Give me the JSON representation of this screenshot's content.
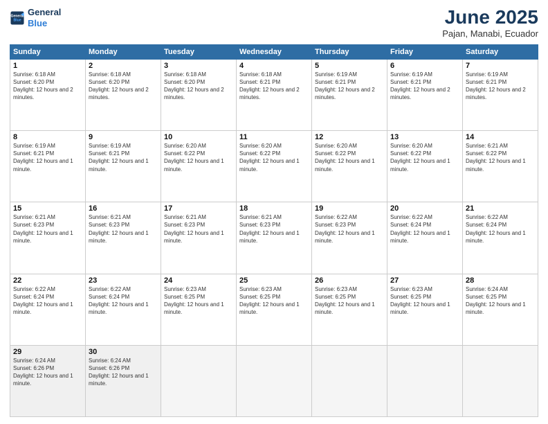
{
  "logo": {
    "line1": "General",
    "line2": "Blue"
  },
  "title": "June 2025",
  "subtitle": "Pajan, Manabi, Ecuador",
  "header_days": [
    "Sunday",
    "Monday",
    "Tuesday",
    "Wednesday",
    "Thursday",
    "Friday",
    "Saturday"
  ],
  "weeks": [
    [
      {
        "day": "1",
        "sunrise": "6:18 AM",
        "sunset": "6:20 PM",
        "daylight": "12 hours and 2 minutes."
      },
      {
        "day": "2",
        "sunrise": "6:18 AM",
        "sunset": "6:20 PM",
        "daylight": "12 hours and 2 minutes."
      },
      {
        "day": "3",
        "sunrise": "6:18 AM",
        "sunset": "6:20 PM",
        "daylight": "12 hours and 2 minutes."
      },
      {
        "day": "4",
        "sunrise": "6:18 AM",
        "sunset": "6:21 PM",
        "daylight": "12 hours and 2 minutes."
      },
      {
        "day": "5",
        "sunrise": "6:19 AM",
        "sunset": "6:21 PM",
        "daylight": "12 hours and 2 minutes."
      },
      {
        "day": "6",
        "sunrise": "6:19 AM",
        "sunset": "6:21 PM",
        "daylight": "12 hours and 2 minutes."
      },
      {
        "day": "7",
        "sunrise": "6:19 AM",
        "sunset": "6:21 PM",
        "daylight": "12 hours and 2 minutes."
      }
    ],
    [
      {
        "day": "8",
        "sunrise": "6:19 AM",
        "sunset": "6:21 PM",
        "daylight": "12 hours and 1 minute."
      },
      {
        "day": "9",
        "sunrise": "6:19 AM",
        "sunset": "6:21 PM",
        "daylight": "12 hours and 1 minute."
      },
      {
        "day": "10",
        "sunrise": "6:20 AM",
        "sunset": "6:22 PM",
        "daylight": "12 hours and 1 minute."
      },
      {
        "day": "11",
        "sunrise": "6:20 AM",
        "sunset": "6:22 PM",
        "daylight": "12 hours and 1 minute."
      },
      {
        "day": "12",
        "sunrise": "6:20 AM",
        "sunset": "6:22 PM",
        "daylight": "12 hours and 1 minute."
      },
      {
        "day": "13",
        "sunrise": "6:20 AM",
        "sunset": "6:22 PM",
        "daylight": "12 hours and 1 minute."
      },
      {
        "day": "14",
        "sunrise": "6:21 AM",
        "sunset": "6:22 PM",
        "daylight": "12 hours and 1 minute."
      }
    ],
    [
      {
        "day": "15",
        "sunrise": "6:21 AM",
        "sunset": "6:23 PM",
        "daylight": "12 hours and 1 minute."
      },
      {
        "day": "16",
        "sunrise": "6:21 AM",
        "sunset": "6:23 PM",
        "daylight": "12 hours and 1 minute."
      },
      {
        "day": "17",
        "sunrise": "6:21 AM",
        "sunset": "6:23 PM",
        "daylight": "12 hours and 1 minute."
      },
      {
        "day": "18",
        "sunrise": "6:21 AM",
        "sunset": "6:23 PM",
        "daylight": "12 hours and 1 minute."
      },
      {
        "day": "19",
        "sunrise": "6:22 AM",
        "sunset": "6:23 PM",
        "daylight": "12 hours and 1 minute."
      },
      {
        "day": "20",
        "sunrise": "6:22 AM",
        "sunset": "6:24 PM",
        "daylight": "12 hours and 1 minute."
      },
      {
        "day": "21",
        "sunrise": "6:22 AM",
        "sunset": "6:24 PM",
        "daylight": "12 hours and 1 minute."
      }
    ],
    [
      {
        "day": "22",
        "sunrise": "6:22 AM",
        "sunset": "6:24 PM",
        "daylight": "12 hours and 1 minute."
      },
      {
        "day": "23",
        "sunrise": "6:22 AM",
        "sunset": "6:24 PM",
        "daylight": "12 hours and 1 minute."
      },
      {
        "day": "24",
        "sunrise": "6:23 AM",
        "sunset": "6:25 PM",
        "daylight": "12 hours and 1 minute."
      },
      {
        "day": "25",
        "sunrise": "6:23 AM",
        "sunset": "6:25 PM",
        "daylight": "12 hours and 1 minute."
      },
      {
        "day": "26",
        "sunrise": "6:23 AM",
        "sunset": "6:25 PM",
        "daylight": "12 hours and 1 minute."
      },
      {
        "day": "27",
        "sunrise": "6:23 AM",
        "sunset": "6:25 PM",
        "daylight": "12 hours and 1 minute."
      },
      {
        "day": "28",
        "sunrise": "6:24 AM",
        "sunset": "6:25 PM",
        "daylight": "12 hours and 1 minute."
      }
    ],
    [
      {
        "day": "29",
        "sunrise": "6:24 AM",
        "sunset": "6:26 PM",
        "daylight": "12 hours and 1 minute."
      },
      {
        "day": "30",
        "sunrise": "6:24 AM",
        "sunset": "6:26 PM",
        "daylight": "12 hours and 1 minute."
      },
      null,
      null,
      null,
      null,
      null
    ]
  ]
}
